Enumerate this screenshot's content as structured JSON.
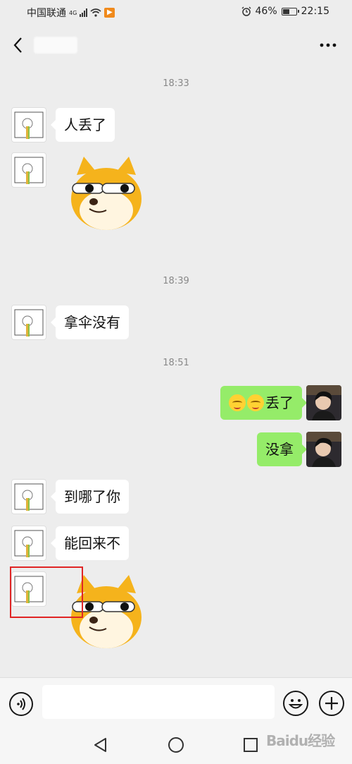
{
  "status_bar": {
    "carrier": "中国联通",
    "network": "4G",
    "alarm_icon": "alarm-clock-icon",
    "battery_percent": "46%",
    "battery_level": 0.46,
    "time": "22:15"
  },
  "header": {
    "back_icon": "chevron-left-icon",
    "title": "",
    "more_icon": "more-dots-icon"
  },
  "messages": {
    "t1": "18:33",
    "m1": "人丢了",
    "t2": "18:39",
    "m3": "拿伞没有",
    "t3": "18:51",
    "m4": "丢了",
    "m5": "没拿",
    "m6": "到哪了你",
    "m7": "能回来不"
  },
  "input_bar": {
    "placeholder": "",
    "voice_icon": "voice-icon",
    "emoji_icon": "smiley-icon",
    "plus_icon": "plus-icon"
  },
  "colors": {
    "background": "#ededed",
    "incoming_bubble": "#ffffff",
    "outgoing_bubble": "#95ec69",
    "highlight": "#e02525"
  },
  "watermark": "Baidu经验"
}
